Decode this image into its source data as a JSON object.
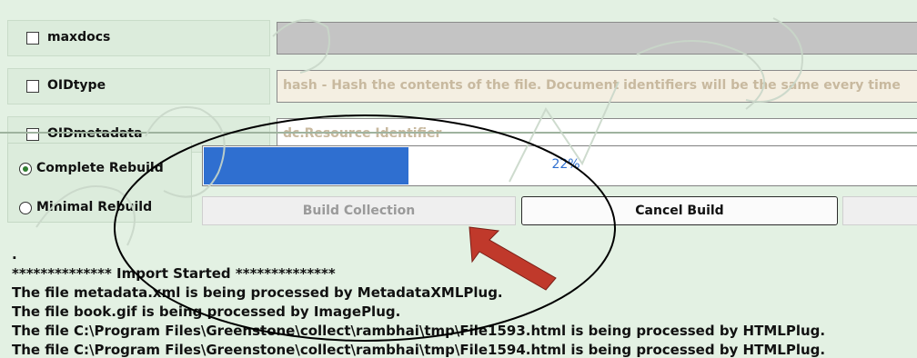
{
  "options": [
    {
      "label": "maxdocs",
      "value": "",
      "field_bg": "#c4c4c4"
    },
    {
      "label": "OIDtype",
      "value": "hash - Hash the contents of the file. Document identifiers will be the same every time",
      "field_bg": "#f4efe2"
    },
    {
      "label": "OIDmetadata",
      "value": "dc.Resource Identifier",
      "field_bg": "#ffffff"
    }
  ],
  "build_modes": [
    {
      "label": "Complete Rebuild",
      "selected": true
    },
    {
      "label": "Minimal Rebuild",
      "selected": false
    }
  ],
  "progress": {
    "percent": 22,
    "text": "22%"
  },
  "buttons": {
    "build": "Build Collection",
    "cancel": "Cancel Build"
  },
  "log": [
    ".",
    "************** Import  Started **************",
    "The file metadata.xml is being processed by MetadataXMLPlug.",
    "The file book.gif is being processed by ImagePlug.",
    "The file C:\\Program Files\\Greenstone\\collect\\rambhai\\tmp\\File1593.html is being processed by HTMLPlug.",
    "The file C:\\Program Files\\Greenstone\\collect\\rambhai\\tmp\\File1594.html is being processed by HTMLPlug."
  ],
  "colors": {
    "accent": "#2f6fd0",
    "arrow": "#c0392b"
  }
}
